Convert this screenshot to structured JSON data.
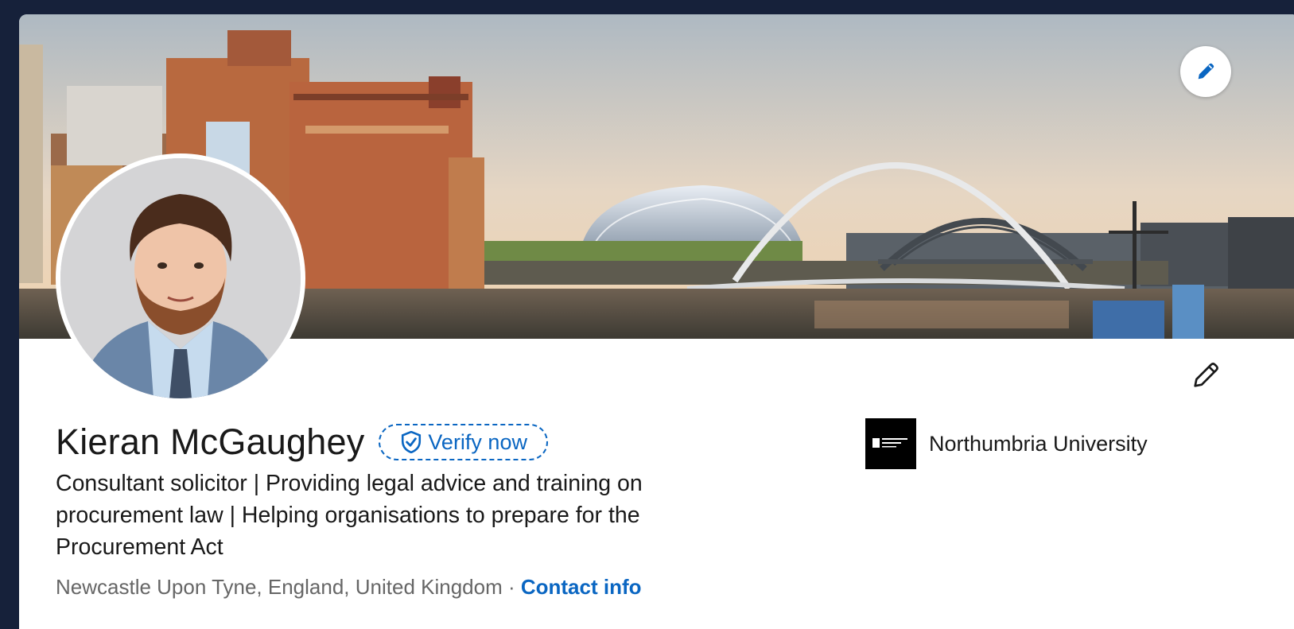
{
  "profile": {
    "name": "Kieran McGaughey",
    "verify_label": "Verify now",
    "headline": "Consultant solicitor | Providing legal advice and training on procurement law | Helping organisations to prepare for the Procurement Act",
    "location": "Newcastle Upon Tyne, England, United Kingdom",
    "separator": " · ",
    "contact_label": "Contact info"
  },
  "education": {
    "name": "Northumbria University",
    "logo_text": "Northumbria University NEWCASTLE"
  },
  "icons": {
    "banner_edit": "pencil-icon",
    "intro_edit": "pencil-icon",
    "verify": "shield-check-icon"
  },
  "colors": {
    "accent": "#0a66c2",
    "text": "#191919",
    "muted": "#666666",
    "page_bg": "#16213a"
  }
}
